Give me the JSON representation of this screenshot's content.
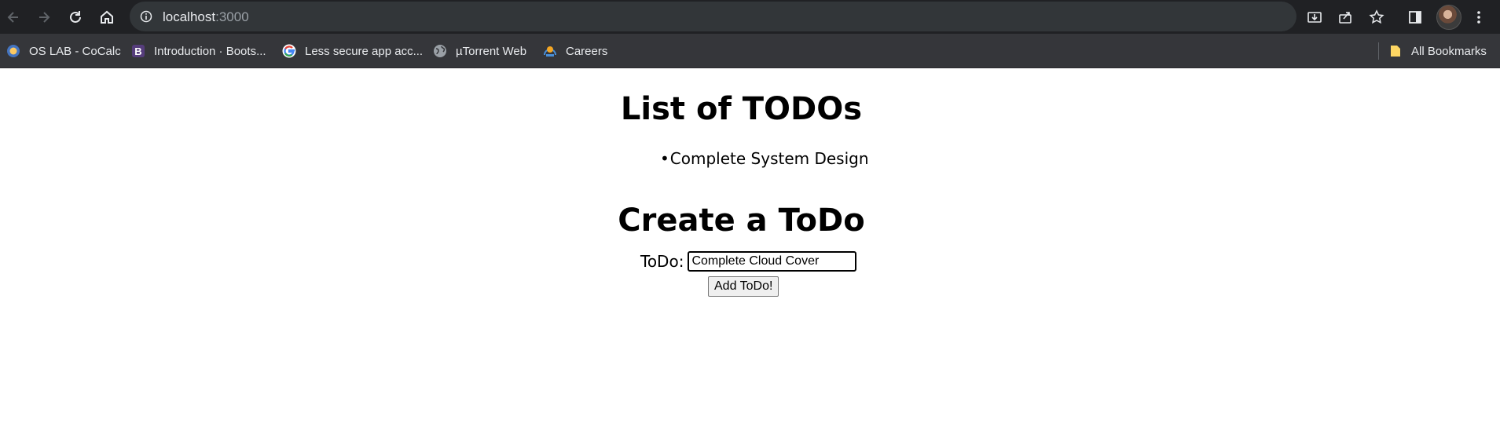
{
  "browser": {
    "url_host": "localhost",
    "url_port": ":3000",
    "bookmarks": [
      {
        "label": "OS LAB - CoCalc",
        "icon": "cocalc-icon"
      },
      {
        "label": "Introduction · Boots...",
        "icon": "bootstrap-icon"
      },
      {
        "label": "Less secure app acc...",
        "icon": "google-icon"
      },
      {
        "label": "µTorrent Web",
        "icon": "globe-icon"
      },
      {
        "label": "Careers",
        "icon": "careers-icon"
      }
    ],
    "all_bookmarks": "All Bookmarks"
  },
  "page": {
    "list_heading": "List of TODOs",
    "todos": [
      "Complete System Design"
    ],
    "bullet": "•",
    "create_heading": "Create a ToDo",
    "form_label": "ToDo:",
    "input_value": "Complete Cloud Cover",
    "add_button": "Add ToDo!"
  },
  "colors": {
    "toolbar_bg": "#202124",
    "omnibox_bg": "#323639",
    "bookmarks_bg": "#35363a",
    "page_bg": "#ffffff"
  }
}
